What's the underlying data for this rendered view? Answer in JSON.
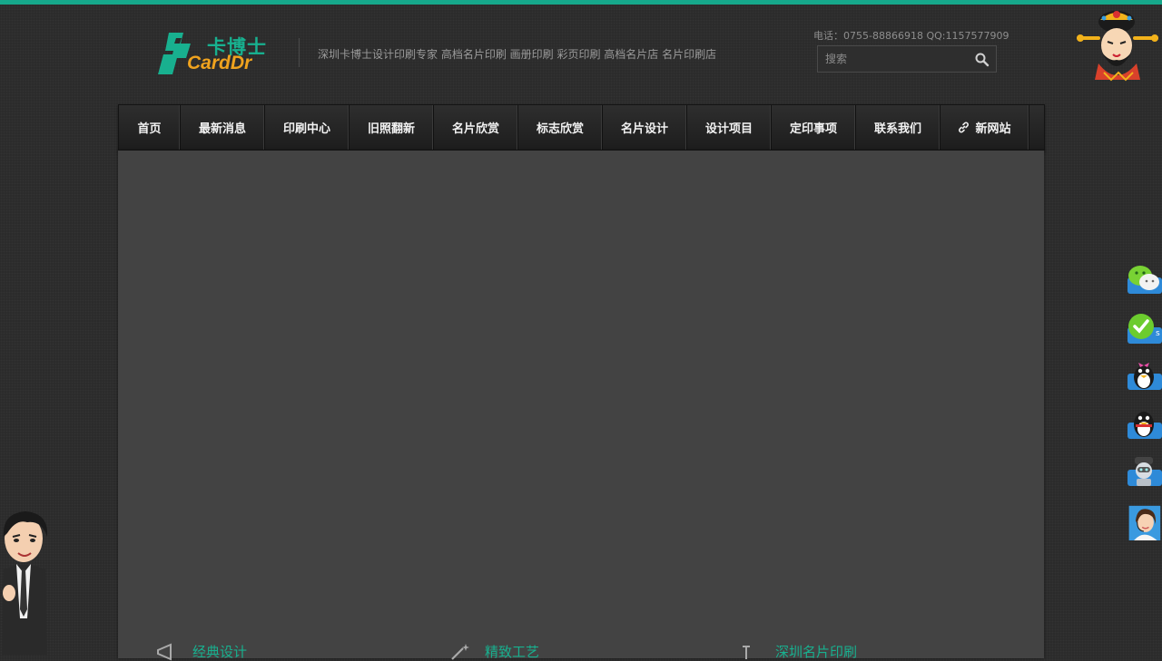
{
  "header": {
    "logo_cn": "卡博士",
    "logo_en": "CardDr",
    "tagline": "深圳卡博士设计印刷专家 高档名片印刷 画册印刷 彩页印刷 高档名片店 名片印刷店",
    "contact": "电话：0755-88866918 QQ:1157577909",
    "search_placeholder": "搜索"
  },
  "nav": {
    "items": [
      {
        "label": "首页"
      },
      {
        "label": "最新消息"
      },
      {
        "label": "印刷中心"
      },
      {
        "label": "旧照翻新"
      },
      {
        "label": "名片欣赏"
      },
      {
        "label": "标志欣赏"
      },
      {
        "label": "名片设计"
      },
      {
        "label": "设计项目"
      },
      {
        "label": "定印事项"
      },
      {
        "label": "联系我们"
      },
      {
        "label": "新网站",
        "icon": "link-icon"
      }
    ]
  },
  "features": [
    {
      "label": "经典设计",
      "icon": "megaphone-icon"
    },
    {
      "label": "精致工艺",
      "icon": "magic-wand-icon"
    },
    {
      "label": "深圳名片印刷",
      "icon": "pin-icon"
    }
  ],
  "side_icons": [
    "wechat-icon",
    "checkmark-badge-icon",
    "qq-penguin-bow-icon",
    "qq-penguin-icon",
    "robot-support-icon",
    "customer-service-icon"
  ],
  "colors": {
    "accent": "#18b08f",
    "logo_orange": "#f0a31e",
    "background": "#2b2b2b",
    "banner": "#434343"
  }
}
